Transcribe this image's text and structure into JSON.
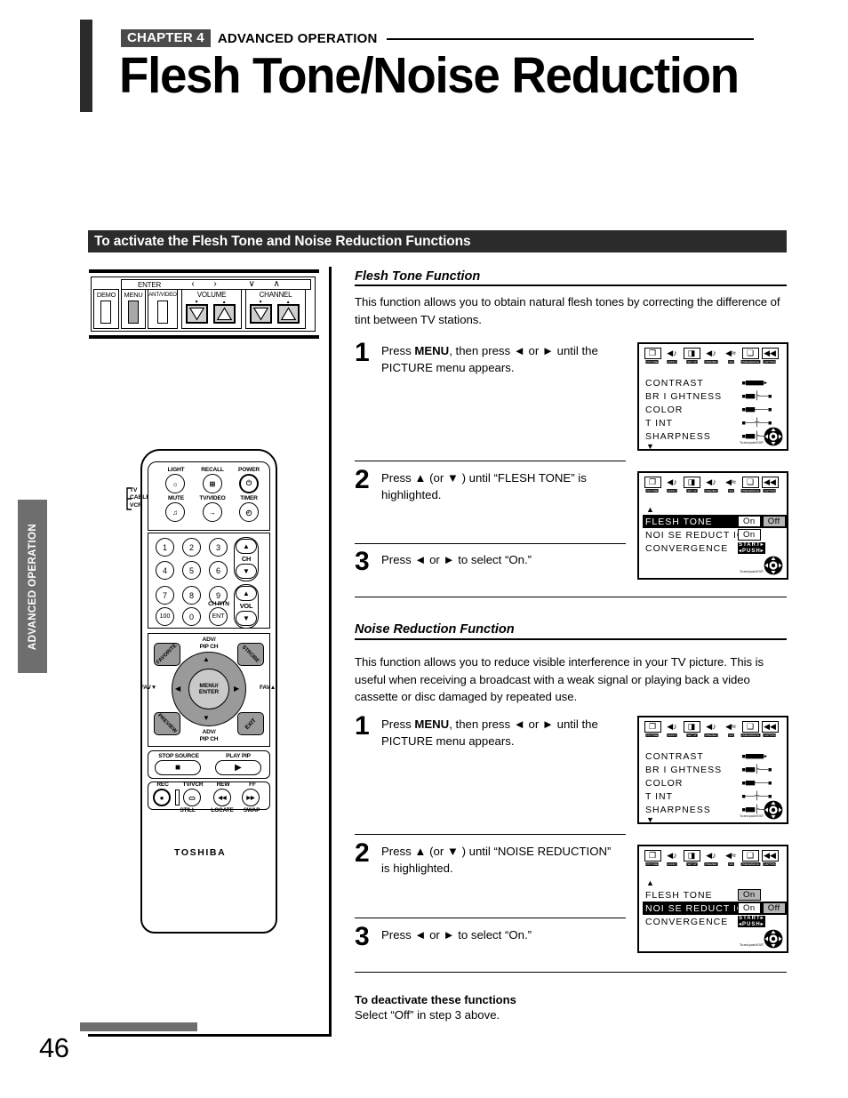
{
  "header": {
    "chapter_badge": "CHAPTER 4",
    "chapter_subtitle": "ADVANCED OPERATION",
    "title": "Flesh Tone/Noise Reduction"
  },
  "section_bar": {
    "title": "To activate the Flesh Tone and Noise Reduction Functions"
  },
  "side_tab": {
    "label": "ADVANCED OPERATION"
  },
  "page_number": "46",
  "tv_panel": {
    "enter_label": "ENTER",
    "arrow_left": "‹",
    "arrow_right": "›",
    "arrow_down": "∨",
    "arrow_up": "∧",
    "demo_label": "DEMO",
    "menu_label": "MENU",
    "antvideo_label": "ANT/VIDEO",
    "volume_label": "VOLUME",
    "channel_label": "CHANNEL",
    "vol_down_mark": "▼",
    "vol_up_mark": "▲",
    "ch_down_mark": "▼",
    "ch_up_mark": "▲"
  },
  "remote": {
    "mode_tv": "TV",
    "mode_cable": "CABLE",
    "mode_vcr": "VCR",
    "light": "LIGHT",
    "recall": "RECALL",
    "power": "POWER",
    "mute": "MUTE",
    "tvvideo": "TV/VIDEO",
    "timer": "TIMER",
    "light_glyph": "☼",
    "recall_glyph": "⊞",
    "power_glyph": "⏻",
    "mute_glyph": "♫",
    "tvvideo_glyph": "→",
    "timer_glyph": "◴",
    "keys": [
      "1",
      "2",
      "3",
      "4",
      "5",
      "6",
      "7",
      "8",
      "9",
      "100",
      "0",
      "ENT"
    ],
    "ch_label": "CH",
    "vol_label": "VOL",
    "ch_rtn": "CH RTN",
    "up_arrow": "▲",
    "down_arrow": "▼",
    "left_arrow": "◀",
    "right_arrow": "▶",
    "favorite": "FAVORITE",
    "strobe": "STROBE",
    "preview": "PREVIEW",
    "exit": "EXIT",
    "fav_down": "FAV▼",
    "fav_up": "FAV▲",
    "adv_pip_ch_top_l1": "ADV/",
    "adv_pip_ch_top_l2": "PIP CH",
    "adv_pip_ch_bot_l1": "ADV/",
    "adv_pip_ch_bot_l2": "PIP CH",
    "menu_enter_l1": "MENU/",
    "menu_enter_l2": "ENTER",
    "stop_source": "STOP SOURCE",
    "play_pip": "PLAY PIP",
    "stop_glyph": "■",
    "play_glyph": "▶",
    "rec": "REC",
    "tv_vcr": "TV/VCR",
    "rew": "REW",
    "ff": "FF",
    "still": "STILL",
    "locate": "LOCATE",
    "swap": "SWAP",
    "rec_glyph": "●",
    "tvvcr_glyph": "▭",
    "rew_glyph": "◀◀",
    "ff_glyph": "▶▶",
    "brand": "TOSHIBA"
  },
  "flesh_tone": {
    "heading": "Flesh Tone Function",
    "body": "This function allows you to obtain natural flesh tones by correcting the difference of tint between TV stations.",
    "steps": [
      {
        "num": "1",
        "pre": "Press ",
        "bold": "MENU",
        "post": ", then press ◄ or ► until the PICTURE menu appears."
      },
      {
        "num": "2",
        "pre": "Press ▲ (or ▼ ) until “FLESH TONE” is highlighted.",
        "bold": "",
        "post": ""
      },
      {
        "num": "3",
        "pre": "Press ◄ or ► to select “On.”",
        "bold": "",
        "post": ""
      }
    ]
  },
  "noise_reduction": {
    "heading": "Noise Reduction Function",
    "body": "This function allows you to reduce visible interference in your TV picture. This is useful when receiving a broadcast with a weak signal or playing back a video cassette or disc damaged by repeated use.",
    "steps": [
      {
        "num": "1",
        "pre": "Press ",
        "bold": "MENU",
        "post": ", then press ◄ or ► until the PICTURE menu appears."
      },
      {
        "num": "2",
        "pre": "Press ▲ (or ▼ ) until “NOISE REDUCTION” is highlighted.",
        "bold": "",
        "post": ""
      },
      {
        "num": "3",
        "pre": "Press ◄ or ► to select “On.”",
        "bold": "",
        "post": ""
      }
    ]
  },
  "footer": {
    "bold": "To deactivate these functions",
    "normal": "Select “Off” in step 3 above."
  },
  "osd": {
    "menu_icons": [
      {
        "name": "picture",
        "glyph": "❐",
        "cap": "PICTURE",
        "boxed": true
      },
      {
        "name": "audio",
        "glyph": "◀♪",
        "cap": "AUDIO",
        "boxed": false
      },
      {
        "name": "setup",
        "glyph": "◨",
        "cap": "SET UP",
        "boxed": true
      },
      {
        "name": "premier",
        "glyph": "◀♪",
        "cap": "PREMIER",
        "boxed": false
      },
      {
        "name": "sis",
        "glyph": "◀≈",
        "cap": "SIS",
        "boxed": false
      },
      {
        "name": "preference",
        "glyph": "❑",
        "cap": "PREFERENCE",
        "boxed": true
      },
      {
        "name": "caption",
        "glyph": "◀◀",
        "cap": "CAPTION",
        "boxed": true
      }
    ],
    "exit_note": "To end push EXIT",
    "picture_menu": {
      "rows": [
        {
          "label": "CONTRAST",
          "bar": "▪■■■■▸"
        },
        {
          "label": "BR I GHTNESS",
          "bar": "▪■■├––▪"
        },
        {
          "label": "COLOR",
          "bar": "▪■■–––▪"
        },
        {
          "label": "T INT",
          "bar": "▪––┼––▪"
        },
        {
          "label": "SHARPNESS",
          "bar": "▪■■├––▪"
        }
      ],
      "scroll_down": "▼"
    },
    "flesh_menu": {
      "scroll_up": "▲",
      "rows": [
        {
          "label": "FLESH  TONE",
          "on": "On",
          "off": "Off",
          "highlighted": true,
          "value_boxed": true
        },
        {
          "label": "NOI SE  REDUCT ION",
          "on": "On",
          "off": "",
          "highlighted": false,
          "value_boxed": true
        },
        {
          "label": "CONVERGENCE",
          "start_l1": "START▸",
          "start_l2": "◂PUSH▸",
          "highlighted": false
        }
      ]
    },
    "noise_menu": {
      "scroll_up": "▲",
      "rows": [
        {
          "label": "FLESH  TONE",
          "on": "On",
          "off": "",
          "highlighted": false,
          "value_boxed": true
        },
        {
          "label": "NOI SE  REDUCT ION",
          "on": "On",
          "off": "Off",
          "highlighted": true,
          "value_boxed": true
        },
        {
          "label": "CONVERGENCE",
          "start_l1": "START▸",
          "start_l2": "◂PUSH▸",
          "highlighted": false
        }
      ]
    }
  }
}
